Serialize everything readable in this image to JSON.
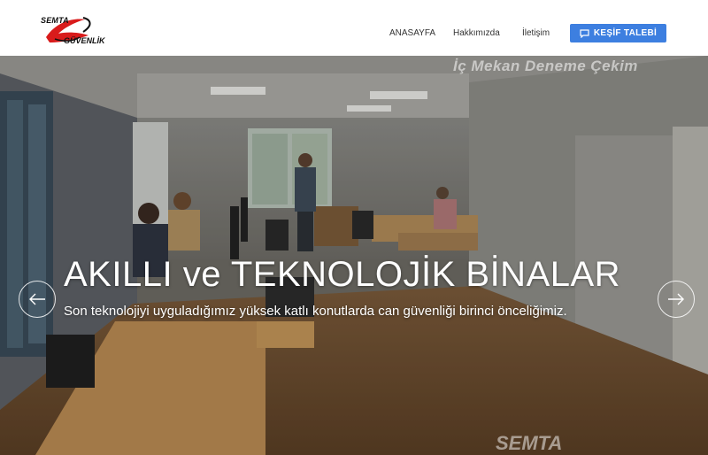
{
  "brand": {
    "top": "SEMTA",
    "bottom": "GÜVENLİK",
    "accent": "#d91b1b"
  },
  "nav": {
    "home": "ANASAYFA",
    "about": "Hakkımızda",
    "contact": "İletişim"
  },
  "cta": {
    "label": "KEŞİF TALEBİ",
    "icon": "chat-icon",
    "color": "#3d7fe0"
  },
  "hero": {
    "watermark_top": "İç Mekan Deneme Çekim",
    "watermark_bottom": "SEMTA",
    "title": "AKILLI ve TEKNOLOJİK BİNALAR",
    "subtitle": "Son teknolojiyi uyguladığımız yüksek katlı konutlarda can güvenliği birinci önceliğimiz.",
    "prev_icon": "arrow-left-icon",
    "next_icon": "arrow-right-icon"
  }
}
